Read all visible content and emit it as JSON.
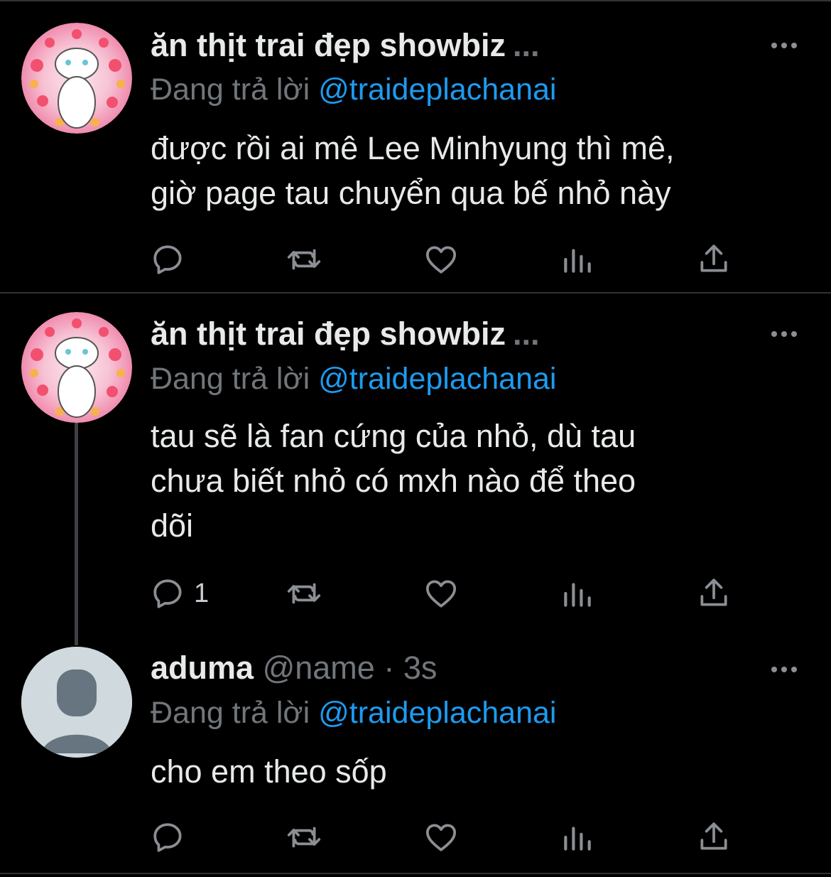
{
  "tweets": [
    {
      "name": "ăn thịt trai đẹp showbiz",
      "name_ellipsis": "...",
      "reply_prefix": "Đang trả lời",
      "reply_to": "@traideplachanai",
      "text_lines": [
        "được rồi ai mê Lee Minhyung thì mê,",
        "giờ page tau chuyển qua bế nhỏ này"
      ],
      "reply_count": ""
    },
    {
      "name": "ăn thịt trai đẹp showbiz",
      "name_ellipsis": "...",
      "reply_prefix": "Đang trả lời",
      "reply_to": "@traideplachanai",
      "text_lines": [
        "tau sẽ là fan cứng của nhỏ, dù tau",
        "chưa biết nhỏ có mxh nào để theo",
        "dõi"
      ],
      "reply_count": "1"
    },
    {
      "name": "aduma",
      "handle": "@name",
      "separator": "·",
      "time": "3s",
      "reply_prefix": "Đang trả lời",
      "reply_to": "@traideplachanai",
      "text_lines": [
        "cho em theo sốp"
      ],
      "reply_count": ""
    }
  ],
  "icons": {
    "reply": "reply-icon",
    "retweet": "retweet-icon",
    "like": "heart-icon",
    "analytics": "analytics-icon",
    "share": "share-icon",
    "more": "more-icon"
  },
  "colors": {
    "background": "#000000",
    "mention": "#1d9bf0",
    "muted": "#71767b",
    "divider": "#2f3336"
  }
}
